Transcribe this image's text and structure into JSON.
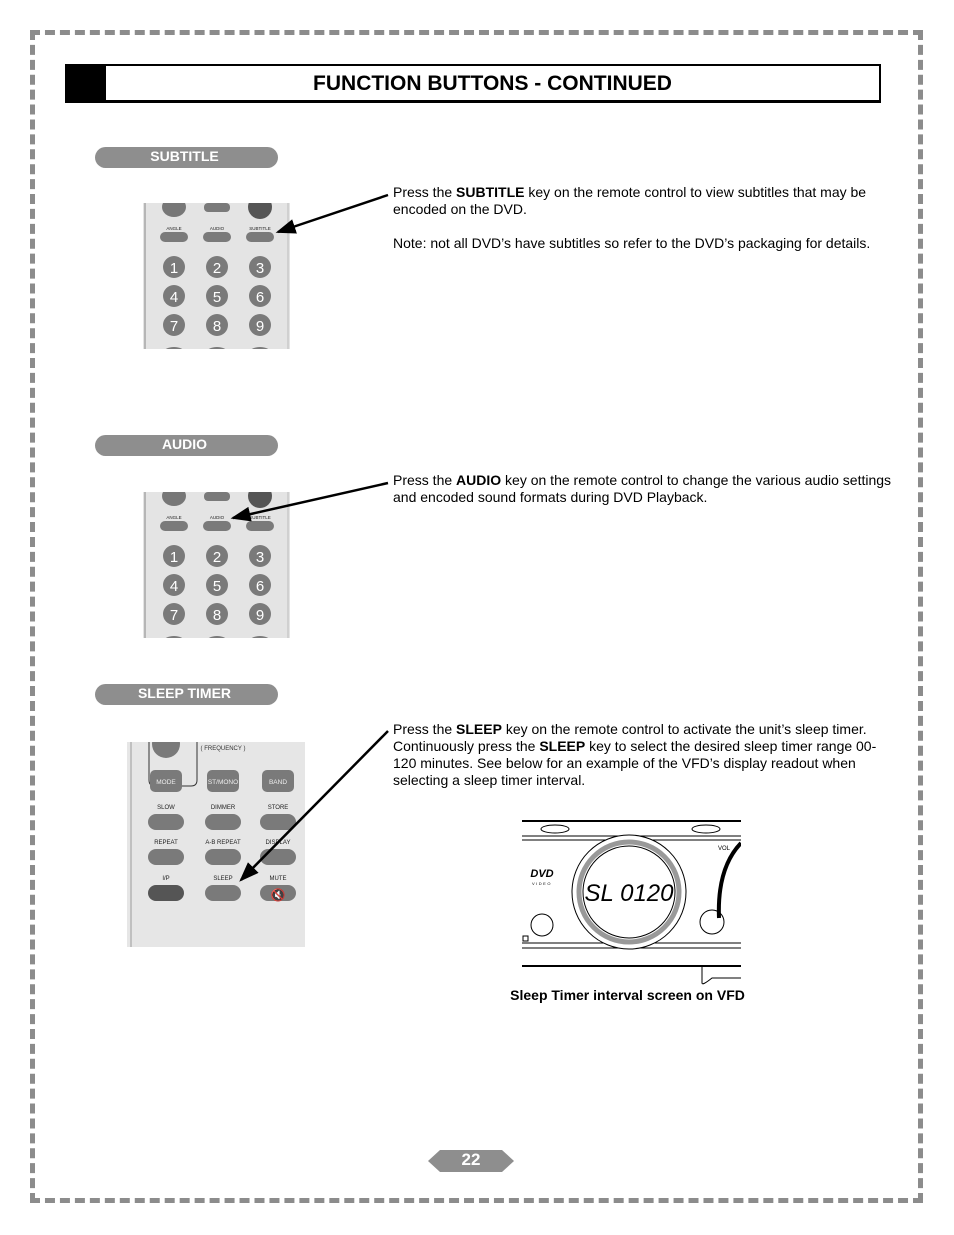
{
  "header": {
    "title": "FUNCTION BUTTONS - CONTINUED"
  },
  "sections": [
    {
      "label": "SUBTITLE",
      "paragraphs": [
        {
          "pre": "Press the ",
          "key": "SUBTITLE",
          "post": " key on the remote control to view subtitles that may be encoded on the DVD."
        },
        {
          "pre": "Note: not all DVD’s have subtitles so refer to the DVD’s packaging for details.",
          "key": "",
          "post": ""
        }
      ]
    },
    {
      "label": "AUDIO",
      "paragraphs": [
        {
          "pre": "Press the ",
          "key": "AUDIO",
          "post": " key on the remote control to change the various audio settings and encoded sound formats during DVD Playback."
        }
      ]
    },
    {
      "label": "SLEEP TIMER",
      "paragraphs": [
        {
          "pre": "Press the ",
          "key": "SLEEP",
          "post": " key on the remote control to activate the unit’s sleep timer. Continuously press the ",
          "key2": "SLEEP",
          "post2": " key to select the desired sleep timer range 00-120 minutes.  See below for an example of the VFD’s display readout when selecting a sleep timer interval."
        }
      ]
    }
  ],
  "remote_top": {
    "labels": [
      "ANGLE",
      "AUDIO",
      "SUBTITLE"
    ],
    "digits": [
      "1",
      "2",
      "3",
      "4",
      "5",
      "6",
      "7",
      "8",
      "9"
    ]
  },
  "remote_sleep": {
    "freq": "( FREQUENCY )",
    "row1": [
      "MODE",
      "ST/MONO",
      "BAND"
    ],
    "row2": [
      "SLOW",
      "DIMMER",
      "STORE"
    ],
    "row3": [
      "REPEAT",
      "A-B REPEAT",
      "DISPLAY"
    ],
    "row4": [
      "I/P",
      "SLEEP",
      "MUTE"
    ]
  },
  "vfd": {
    "readout": "SL 0120",
    "logo": "DVD",
    "logo_sub": "VIDEO",
    "vol": "VOL",
    "caption": "Sleep Timer interval screen on VFD"
  },
  "page_number": "22",
  "colors": {
    "border": "#8c8c8c",
    "pill": "#8e8e8e",
    "button": "#7a7a7a",
    "remote_body": "#e4e4e4"
  }
}
